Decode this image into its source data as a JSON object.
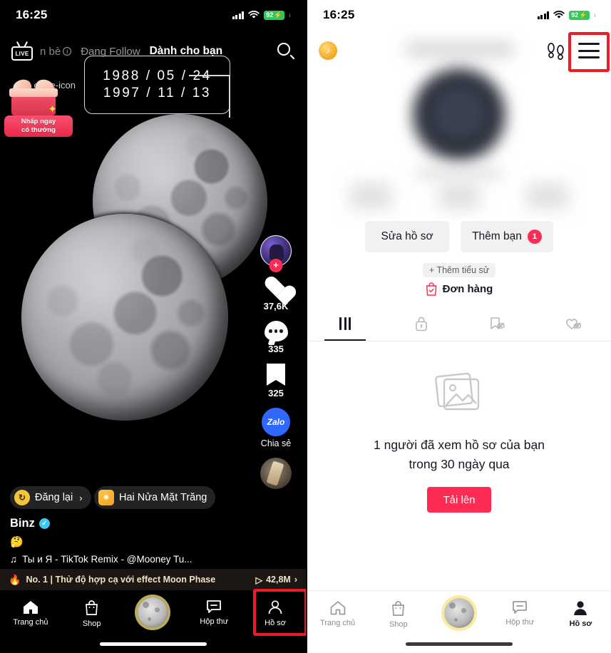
{
  "left_phone": {
    "status_bar": {
      "time": "16:25",
      "battery": "92",
      "signal_icon": "cellular-bars-icon",
      "wifi_icon": "wifi-icon",
      "battery_icon": "battery-charging-icon"
    },
    "top_nav": {
      "live_label": "LIVE",
      "tabs": [
        {
          "label": "n bè",
          "state": "inactive",
          "has_info_icon": true
        },
        {
          "label": "Đang Follow",
          "state": "inactive"
        },
        {
          "label": "Dành cho bạn",
          "state": "active"
        }
      ],
      "search_icon": "search-icon"
    },
    "date_overlay": {
      "line1": "1988 / 05 / 24",
      "line2": "1997 / 11 / 13"
    },
    "promo": {
      "close_icon": "close-icon",
      "line1": "Nhấp ngay",
      "line2": "có thưởng"
    },
    "action_rail": {
      "avatar_plus": "+",
      "like": {
        "icon": "heart-icon",
        "count": "37,6K"
      },
      "comment": {
        "icon": "comment-icon",
        "count": "335"
      },
      "bookmark": {
        "icon": "bookmark-icon",
        "count": "325"
      },
      "share": {
        "icon": "zalo-icon",
        "brand": "Zalo",
        "label": "Chia sẻ"
      },
      "sound_disc": "sound-disc-icon"
    },
    "video_info": {
      "repost_label": "Đăng lại",
      "repost_arrow": "›",
      "effect_label": "Hai Nửa Mặt Trăng",
      "author": "Binz",
      "verified_icon": "verified-badge-icon",
      "caption": "🤔",
      "music_note": "♫",
      "music": "Ты и Я - TikTok Remix - @Mooney Tu..."
    },
    "trending_banner": {
      "flame_icon": "flame-icon",
      "text": "No. 1 | Thử độ hợp cạ với effect Moon Phase",
      "plays": "42,8M",
      "play_icon": "play-icon",
      "arrow": "›"
    },
    "bottom_nav": {
      "items": [
        {
          "label": "Trang chủ",
          "icon": "home-icon"
        },
        {
          "label": "Shop",
          "icon": "shop-bag-icon"
        },
        {
          "label": "",
          "icon": "moon-create-icon"
        },
        {
          "label": "Hộp thư",
          "icon": "inbox-icon"
        },
        {
          "label": "Hồ sơ",
          "icon": "profile-person-icon",
          "highlighted": true
        }
      ]
    }
  },
  "right_phone": {
    "status_bar": {
      "time": "16:25",
      "battery": "92",
      "signal_icon": "cellular-bars-icon",
      "wifi_icon": "wifi-icon",
      "battery_icon": "battery-charging-icon"
    },
    "header": {
      "coin_icon": "tiktok-coin-icon",
      "footsteps_icon": "footsteps-icon",
      "menu_icon": "hamburger-menu-icon",
      "menu_highlighted": true
    },
    "profile": {
      "edit_profile_label": "Sửa hồ sơ",
      "add_friends_label": "Thêm bạn",
      "add_friends_badge": "1",
      "add_bio_label": "+ Thêm tiểu sử",
      "orders_label": "Đơn hàng",
      "orders_icon": "order-bag-icon"
    },
    "tabs": [
      {
        "icon": "grid-icon",
        "active": true
      },
      {
        "icon": "lock-icon",
        "active": false
      },
      {
        "icon": "bookmark-hidden-icon",
        "active": false
      },
      {
        "icon": "heart-hidden-icon",
        "active": false
      }
    ],
    "empty_state": {
      "image_icon": "photos-placeholder-icon",
      "line1": "1 người đã xem hồ sơ của bạn",
      "line2": "trong 30 ngày qua",
      "upload_label": "Tải lên"
    },
    "bottom_nav": {
      "items": [
        {
          "label": "Trang chủ",
          "icon": "home-icon"
        },
        {
          "label": "Shop",
          "icon": "shop-bag-icon"
        },
        {
          "label": "",
          "icon": "moon-create-icon"
        },
        {
          "label": "Hộp thư",
          "icon": "inbox-icon"
        },
        {
          "label": "Hồ sơ",
          "icon": "profile-person-icon",
          "active": true
        }
      ]
    }
  },
  "colors": {
    "accent_red": "#fe2c55",
    "highlight_box": "#ee1b24",
    "battery_green": "#34c759",
    "zalo_blue": "#2f68ff",
    "banner_text": "#efe3c4",
    "chip_yellow": "#f3c53c",
    "verified_blue": "#3ec8f2"
  }
}
